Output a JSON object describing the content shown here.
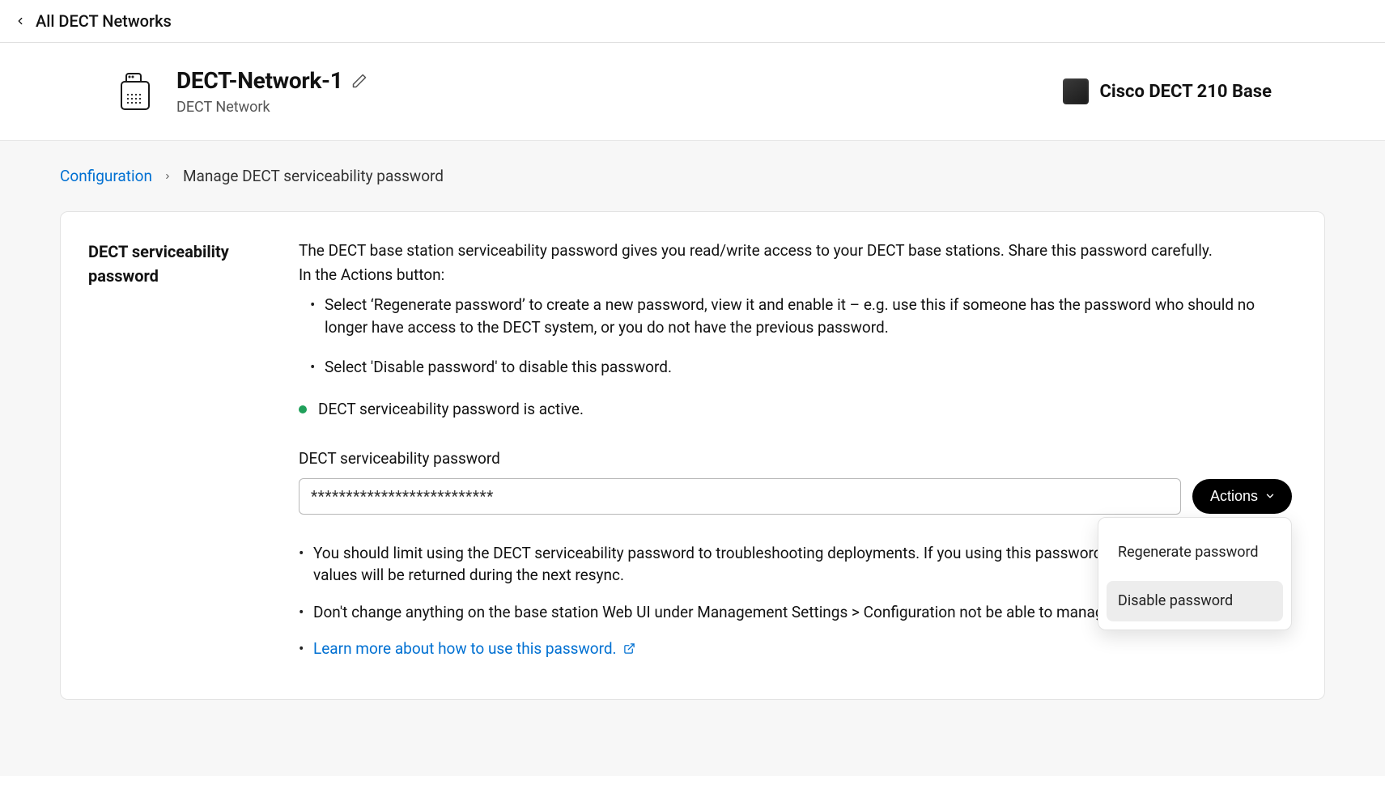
{
  "back_bar": {
    "label": "All DECT Networks"
  },
  "header": {
    "title": "DECT-Network-1",
    "subtitle": "DECT Network",
    "base_label": "Cisco DECT 210 Base"
  },
  "breadcrumbs": {
    "link": "Configuration",
    "current": "Manage DECT serviceability password"
  },
  "section": {
    "left_title": "DECT serviceability password",
    "intro1": "The DECT base station serviceability password gives you read/write access to your DECT base stations. Share this password carefully.",
    "intro2": "In the Actions button:",
    "bullets": [
      "Select ‘Regenerate password’ to create a new password, view it and enable it – e.g. use this if someone has the password who should no longer have access to the DECT system, or you do not have the previous password.",
      "Select 'Disable password' to disable this password."
    ],
    "status_text": "DECT serviceability password is active.",
    "field_label": "DECT serviceability password",
    "password_masked": "**************************",
    "actions_label": "Actions",
    "dropdown": {
      "regenerate": "Regenerate password",
      "disable": "Disable password"
    },
    "notes": [
      "You should limit using the DECT serviceability password to troubleshooting deployments. If you using this password, Webex Calling defined values will be returned during the next resync.",
      "Don't change anything on the base station Web UI under Management Settings > Configuration not be able to manage your system."
    ],
    "learn_more": "Learn more about how to use this password."
  },
  "colors": {
    "link": "#0070d2",
    "status_green": "#1fa05a"
  }
}
